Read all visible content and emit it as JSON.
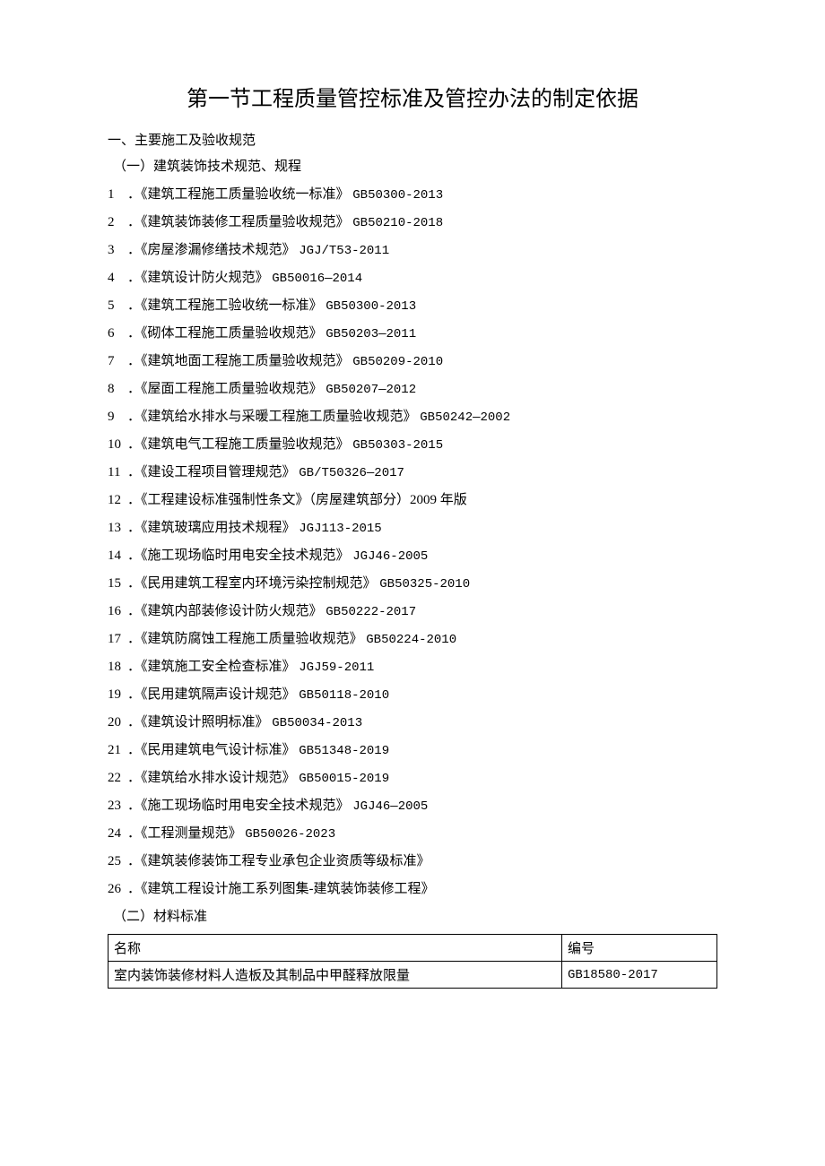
{
  "title": "第一节工程质量管控标准及管控办法的制定依据",
  "section1": "一、主要施工及验收规范",
  "sub1": "（一）建筑装饰技术规范、规程",
  "items": [
    {
      "n": "1",
      "dot": "．",
      "text": "《建筑工程施工质量验收统一标准》",
      "code": "GB50300-2013"
    },
    {
      "n": "2",
      "dot": "．",
      "text": "《建筑装饰装修工程质量验收规范》",
      "code": "GB50210-2018"
    },
    {
      "n": "3",
      "dot": "．",
      "text": "《房屋渗漏修缮技术规范》",
      "code": "JGJ/T53-2011"
    },
    {
      "n": "4",
      "dot": "．",
      "text": "《建筑设计防火规范》",
      "code": "GB50016—2014"
    },
    {
      "n": "5",
      "dot": "．",
      "text": "《建筑工程施工验收统一标准》",
      "code": "GB50300-2013"
    },
    {
      "n": "6",
      "dot": "．",
      "text": "《砌体工程施工质量验收规范》",
      "code": "GB50203—2011"
    },
    {
      "n": "7",
      "dot": "．",
      "text": "《建筑地面工程施工质量验收规范》",
      "code": "GB50209-2010"
    },
    {
      "n": "8",
      "dot": "．",
      "text": "《屋面工程施工质量验收规范》",
      "code": "GB50207—2012"
    },
    {
      "n": "9",
      "dot": "．",
      "text": "《建筑给水排水与采暖工程施工质量验收规范》",
      "code": "GB50242—2002"
    },
    {
      "n": "10",
      "dot": "．",
      "text": "《建筑电气工程施工质量验收规范》",
      "code": "GB50303-2015"
    },
    {
      "n": "11",
      "dot": "．",
      "text": "《建设工程项目管理规范》",
      "code": "GB/T50326—2017"
    },
    {
      "n": "12",
      "dot": "．",
      "text": "《工程建设标准强制性条文》（房屋建筑部分）2009 年版",
      "code": ""
    },
    {
      "n": "13",
      "dot": "．",
      "text": "《建筑玻璃应用技术规程》",
      "code": "JGJ113-2015"
    },
    {
      "n": "14",
      "dot": "．",
      "text": "《施工现场临时用电安全技术规范》",
      "code": "JGJ46-2005"
    },
    {
      "n": "15",
      "dot": "．",
      "text": "《民用建筑工程室内环境污染控制规范》",
      "code": "GB50325-2010"
    },
    {
      "n": "16",
      "dot": "．",
      "text": "《建筑内部装修设计防火规范》",
      "code": "GB50222-2017"
    },
    {
      "n": "17",
      "dot": "．",
      "text": "《建筑防腐蚀工程施工质量验收规范》",
      "code": "GB50224-2010"
    },
    {
      "n": "18",
      "dot": "．",
      "text": "《建筑施工安全检查标准》",
      "code": "JGJ59-2011"
    },
    {
      "n": "19",
      "dot": "．",
      "text": "《民用建筑隔声设计规范》",
      "code": "GB50118-2010"
    },
    {
      "n": "20",
      "dot": "．",
      "text": "《建筑设计照明标准》",
      "code": "GB50034-2013"
    },
    {
      "n": "21",
      "dot": "．",
      "text": "《民用建筑电气设计标准》",
      "code": "GB51348-2019"
    },
    {
      "n": "22",
      "dot": "．",
      "text": "《建筑给水排水设计规范》",
      "code": "GB50015-2019"
    },
    {
      "n": "23",
      "dot": "．",
      "text": "《施工现场临时用电安全技术规范》",
      "code": "JGJ46—2005"
    },
    {
      "n": "24",
      "dot": "．",
      "text": "《工程测量规范》",
      "code": "GB50026-2023"
    },
    {
      "n": "25",
      "dot": "．",
      "text": "《建筑装修装饰工程专业承包企业资质等级标准》",
      "code": ""
    },
    {
      "n": "26",
      "dot": "．",
      "text": "《建筑工程设计施工系列图集-建筑装饰装修工程》",
      "code": ""
    }
  ],
  "sub2": "（二）材料标准",
  "table": {
    "headers": {
      "name": "名称",
      "code": "编号"
    },
    "rows": [
      {
        "name": "室内装饰装修材料人造板及其制品中甲醛释放限量",
        "code": "GB18580-2017"
      }
    ]
  }
}
